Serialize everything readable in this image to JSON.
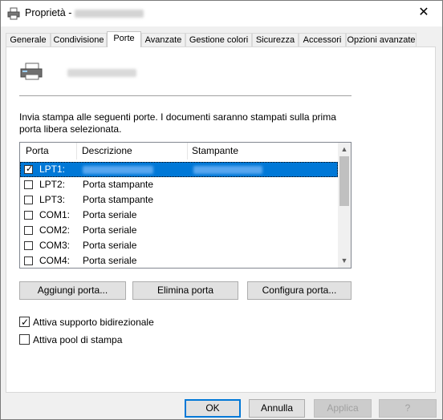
{
  "window": {
    "title": "Proprietà -",
    "close_glyph": "✕"
  },
  "tabs": [
    {
      "label": "Generale"
    },
    {
      "label": "Condivisione"
    },
    {
      "label": "Porte"
    },
    {
      "label": "Avanzate"
    },
    {
      "label": "Gestione colori"
    },
    {
      "label": "Sicurezza"
    },
    {
      "label": "Accessori"
    },
    {
      "label": "Opzioni avanzate"
    }
  ],
  "active_tab": "Porte",
  "ports_panel": {
    "description": "Invia stampa alle seguenti porte. I documenti saranno stampati sulla prima porta libera selezionata.",
    "columns": {
      "port": "Porta",
      "description": "Descrizione",
      "printer": "Stampante"
    },
    "rows": [
      {
        "port": "LPT1:",
        "description": "",
        "checked": true,
        "selected": true
      },
      {
        "port": "LPT2:",
        "description": "Porta stampante",
        "checked": false,
        "selected": false
      },
      {
        "port": "LPT3:",
        "description": "Porta stampante",
        "checked": false,
        "selected": false
      },
      {
        "port": "COM1:",
        "description": "Porta seriale",
        "checked": false,
        "selected": false
      },
      {
        "port": "COM2:",
        "description": "Porta seriale",
        "checked": false,
        "selected": false
      },
      {
        "port": "COM3:",
        "description": "Porta seriale",
        "checked": false,
        "selected": false
      },
      {
        "port": "COM4:",
        "description": "Porta seriale",
        "checked": false,
        "selected": false
      }
    ],
    "check_glyph": "✓",
    "buttons": {
      "add": "Aggiungi porta...",
      "delete": "Elimina porta",
      "configure": "Configura porta..."
    },
    "options": {
      "bidirectional": {
        "label": "Attiva supporto bidirezionale",
        "checked": true
      },
      "pooling": {
        "label": "Attiva pool di stampa",
        "checked": false
      }
    }
  },
  "footer": {
    "ok": "OK",
    "cancel": "Annulla",
    "apply": "Applica",
    "help": "?"
  },
  "colors": {
    "selection": "#0078d7",
    "panel": "#ffffff",
    "window": "#f0f0f0"
  }
}
